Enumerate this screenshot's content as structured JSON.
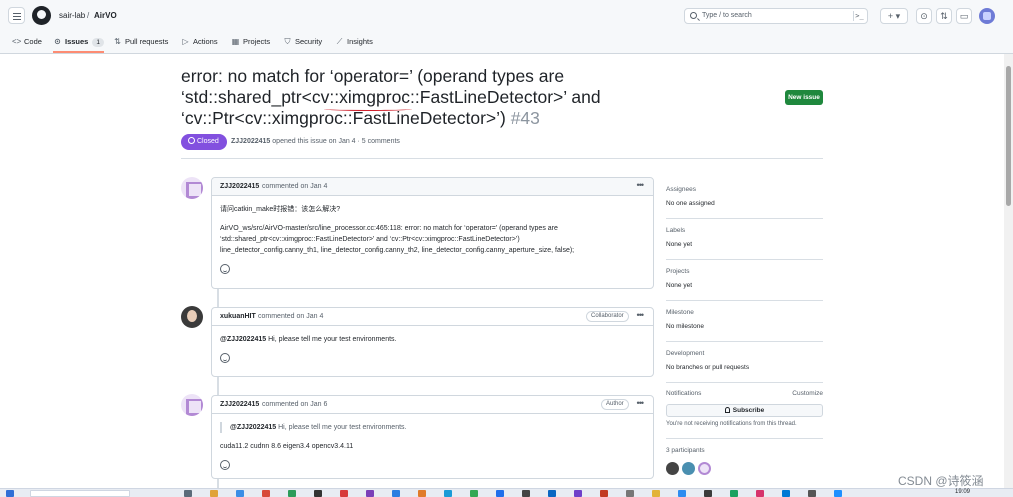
{
  "header": {
    "owner": "sair-lab",
    "separator": "/",
    "repo": "AirVO",
    "search_placeholder": "Type / to search",
    "search_shortcut": ">_",
    "plus_label": "+ ▾",
    "issues_icon": "issue-opened-icon",
    "pr_icon": "git-pull-request-icon",
    "inbox_icon": "inbox-icon"
  },
  "nav": {
    "tabs": [
      {
        "label": "Code",
        "icon": "<>"
      },
      {
        "label": "Issues",
        "icon": "⊙",
        "count": "1"
      },
      {
        "label": "Pull requests",
        "icon": "⇅"
      },
      {
        "label": "Actions",
        "icon": "▷"
      },
      {
        "label": "Projects",
        "icon": "▦"
      },
      {
        "label": "Security",
        "icon": "⛉"
      },
      {
        "label": "Insights",
        "icon": "⟋"
      }
    ]
  },
  "issue": {
    "title_line1": "error: no match for ‘operator=’ (operand types are",
    "title_line2": "‘std::shared_ptr<cv::ximgproc::FastLineDetector>’ and",
    "title_line3": "‘cv::Ptr<cv::ximgproc::FastLineDetector>’)",
    "number": "#43",
    "state": "Closed",
    "author": "ZJJ2022415",
    "meta_rest": "opened this issue on Jan 4 · 5 comments",
    "new_issue_label": "New issue"
  },
  "comments": [
    {
      "author": "ZJJ2022415",
      "date": "commented on Jan 4",
      "body_1": "请问catkin_make时报错：该怎么解决?",
      "body_2a": "AirVO_ws/src/AirVO-master/src/line_processor.cc:465:118: error: no match for ‘operator=’ (operand types are",
      "body_2b": "‘std::shared_ptr<cv::ximgproc::FastLineDetector>’ and ‘cv::Ptr<cv::ximgproc::FastLineDetector>’)",
      "body_2c": "line_detector_config.canny_th1, line_detector_config.canny_th2, line_detector_config.canny_aperture_size, false);"
    },
    {
      "author": "xukuanHIT",
      "date": "commented on Jan 4",
      "role": "Collaborator",
      "mention": "@ZJJ2022415",
      "body": "Hi, please tell me your test environments."
    },
    {
      "author": "ZJJ2022415",
      "date": "commented on Jan 6",
      "role": "Author",
      "quote_mention": "@ZJJ2022415",
      "quote_text": "Hi, please tell me your test environments.",
      "body": "cuda11.2 cudnn 8.6 eigen3.4 opencv3.4.11"
    }
  ],
  "sidebar": {
    "assignees_h": "Assignees",
    "assignees_v": "No one assigned",
    "labels_h": "Labels",
    "labels_v": "None yet",
    "projects_h": "Projects",
    "projects_v": "None yet",
    "milestone_h": "Milestone",
    "milestone_v": "No milestone",
    "development_h": "Development",
    "development_v": "No branches or pull requests",
    "notifications_h": "Notifications",
    "customize": "Customize",
    "subscribe_label": "Subscribe",
    "subscribe_note": "You're not receiving notifications from this thread.",
    "participants_h": "3 participants"
  },
  "taskbar": {
    "time": "19:09"
  },
  "watermark": "CSDN @诗筱涵",
  "colors": {
    "closed_purple": "#8250df",
    "new_issue_green": "#1f883d",
    "active_tab_underline": "#fd8c73"
  }
}
